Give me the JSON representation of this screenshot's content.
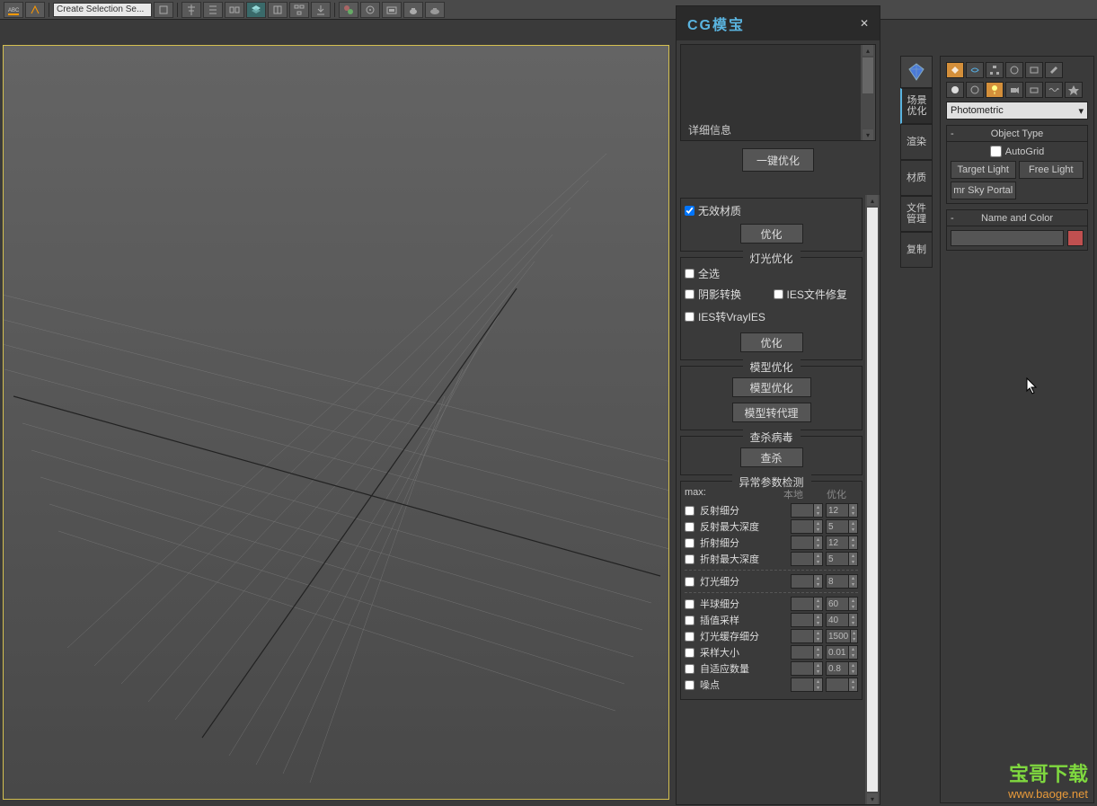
{
  "toolbar": {
    "selection_dropdown": "Create Selection Se..."
  },
  "cg_panel": {
    "title": "CG模宝",
    "detail_label": "详细信息",
    "one_click_optimize": "一键优化",
    "mat_section": {
      "invalid_mat": "无效材质",
      "optimize": "优化"
    },
    "light_section": {
      "title": "灯光优化",
      "select_all": "全选",
      "shadow_convert": "阴影转换",
      "ies_fix": "IES文件修复",
      "ies_to_vray": "IES转VrayIES",
      "optimize": "优化"
    },
    "model_section": {
      "title": "模型优化",
      "model_optimize": "模型优化",
      "model_to_proxy": "模型转代理"
    },
    "virus_section": {
      "title": "查杀病毒",
      "scan": "查杀"
    },
    "param_section": {
      "title": "异常参数检测",
      "max_label": "max:",
      "col_local": "本地",
      "col_opt": "优化",
      "rows": [
        {
          "label": "反射细分",
          "local": "",
          "opt": "12"
        },
        {
          "label": "反射最大深度",
          "local": "",
          "opt": "5"
        },
        {
          "label": "折射细分",
          "local": "",
          "opt": "12"
        },
        {
          "label": "折射最大深度",
          "local": "",
          "opt": "5"
        }
      ],
      "rows2": [
        {
          "label": "灯光细分",
          "local": "",
          "opt": "8"
        }
      ],
      "rows3": [
        {
          "label": "半球细分",
          "local": "",
          "opt": "60"
        },
        {
          "label": "插值采样",
          "local": "",
          "opt": "40"
        },
        {
          "label": "灯光缓存细分",
          "local": "",
          "opt": "1500"
        },
        {
          "label": "采样大小",
          "local": "",
          "opt": "0.01"
        },
        {
          "label": "自适应数量",
          "local": "",
          "opt": "0.8"
        },
        {
          "label": "噪点",
          "local": "",
          "opt": ""
        }
      ]
    }
  },
  "side_tabs": {
    "items": [
      "场景\n优化",
      "渲染",
      "材质",
      "文件\n管理",
      "复制"
    ]
  },
  "cmd_panel": {
    "dropdown": "Photometric",
    "object_type": {
      "title": "Object Type",
      "autogrid": "AutoGrid",
      "btns": [
        "Target Light",
        "Free Light",
        "mr Sky Portal"
      ]
    },
    "name_color": {
      "title": "Name and Color"
    }
  },
  "watermark": {
    "line1": "宝哥下载",
    "line2": "www.baoge.net"
  }
}
